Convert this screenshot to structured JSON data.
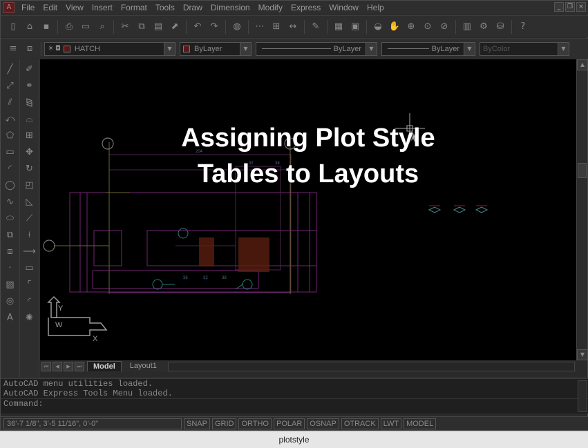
{
  "app": {
    "logo_glyph": "A",
    "window_controls": [
      "_",
      "❐",
      "×"
    ]
  },
  "menu": [
    "File",
    "Edit",
    "View",
    "Insert",
    "Format",
    "Tools",
    "Draw",
    "Dimension",
    "Modify",
    "Express",
    "Window",
    "Help"
  ],
  "properties_bar": {
    "layer": "HATCH",
    "color": "ByLayer",
    "linetype": "ByLayer",
    "lineweight": "ByLayer",
    "plotstyle": "ByColor"
  },
  "tabs": {
    "model": "Model",
    "layout1": "Layout1"
  },
  "command_window": {
    "history": [
      "AutoCAD menu utilities loaded.",
      "AutoCAD Express Tools Menu loaded."
    ],
    "prompt": "Command:"
  },
  "status_bar": {
    "coordinates": "36'-7 1/8\",  3'-5 11/16\", 0'-0\"",
    "toggles": [
      "SNAP",
      "GRID",
      "ORTHO",
      "POLAR",
      "OSNAP",
      "OTRACK",
      "LWT",
      "MODEL"
    ]
  },
  "overlay": {
    "line1": "Assigning Plot Style",
    "line2": "Tables to Layouts"
  },
  "caption": "plotstyle",
  "drawing": {
    "dims": [
      "204",
      "32",
      "38",
      "36",
      "32",
      "38"
    ],
    "ucs_labels": [
      "Y",
      "W",
      "X"
    ]
  },
  "colors": {
    "accent_red": "#5c1818",
    "drawing_magenta": "#8a2a8a",
    "drawing_cyan": "#2a7a7a",
    "drawing_yellow": "#8a8a30"
  }
}
